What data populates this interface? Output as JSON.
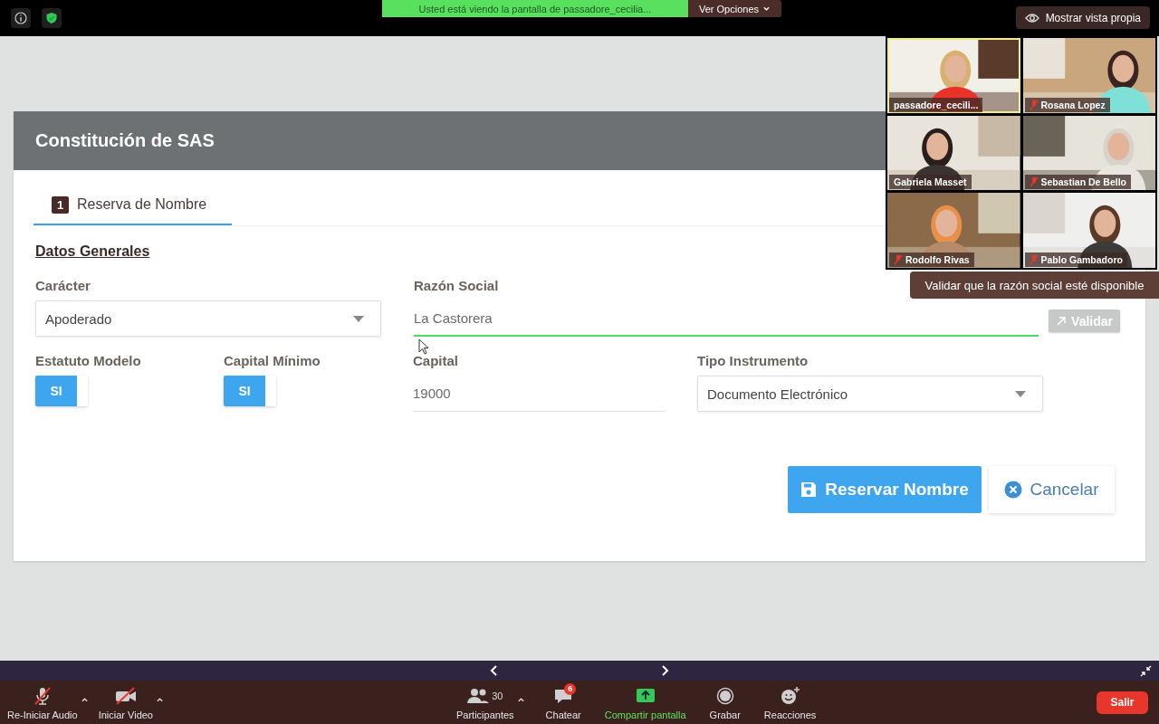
{
  "top_bar": {
    "share_banner": "Usted está viendo la pantalla de passadore_cecilia...",
    "options_button": "Ver Opciones",
    "own_view_button": "Mostrar vista propia"
  },
  "form": {
    "title": "Constitución de SAS",
    "tabs": [
      {
        "number": "1",
        "label": "Reserva de Nombre",
        "selected": true
      }
    ],
    "section": "Datos Generales",
    "fields": [
      {
        "kind": "select",
        "label": "Carácter",
        "value": "Apoderado"
      },
      {
        "kind": "text",
        "label": "Razón Social",
        "value": "La Castorera",
        "focused": true,
        "action": {
          "label": "Validar",
          "disabled": true,
          "tooltip": "Validar que la razón social esté disponible"
        }
      },
      {
        "kind": "toggle",
        "label": "Estatuto Modelo",
        "text": "SI",
        "on": true
      },
      {
        "kind": "toggle",
        "label": "Capital Mínimo",
        "text": "SI",
        "on": true
      },
      {
        "kind": "text",
        "label": "Capital",
        "value": "19000",
        "focused": false
      },
      {
        "kind": "select",
        "label": "Tipo Instrumento",
        "value": "Documento Electrónico"
      }
    ],
    "buttons": [
      {
        "kind": "primary",
        "label": "Reservar Nombre"
      },
      {
        "kind": "secondary",
        "label": "Cancelar"
      }
    ]
  },
  "participants": [
    {
      "name": "passadore_cecili...",
      "muted": false,
      "speaking": true
    },
    {
      "name": "Rosana Lopez",
      "muted": true,
      "speaking": false
    },
    {
      "name": "Gabriela Masset",
      "muted": false,
      "speaking": false
    },
    {
      "name": "Sebastian De Bello",
      "muted": true,
      "speaking": false
    },
    {
      "name": "Rodolfo Rivas",
      "muted": true,
      "speaking": false
    },
    {
      "name": "Pablo Gambadoro",
      "muted": true,
      "speaking": false
    }
  ],
  "toolbar": {
    "items": [
      {
        "kind": "audio",
        "label": "Re-Iniciar Audio",
        "muted": true
      },
      {
        "kind": "video",
        "label": "Iniciar Video",
        "off": true
      },
      {
        "kind": "participants",
        "label": "Participantes",
        "count": "30"
      },
      {
        "kind": "chat",
        "label": "Chatear",
        "badge": "6"
      },
      {
        "kind": "share",
        "label": "Compartir pantalla"
      },
      {
        "kind": "record",
        "label": "Grabar"
      },
      {
        "kind": "reactions",
        "label": "Reacciones"
      }
    ],
    "leave_button": "Salir"
  }
}
